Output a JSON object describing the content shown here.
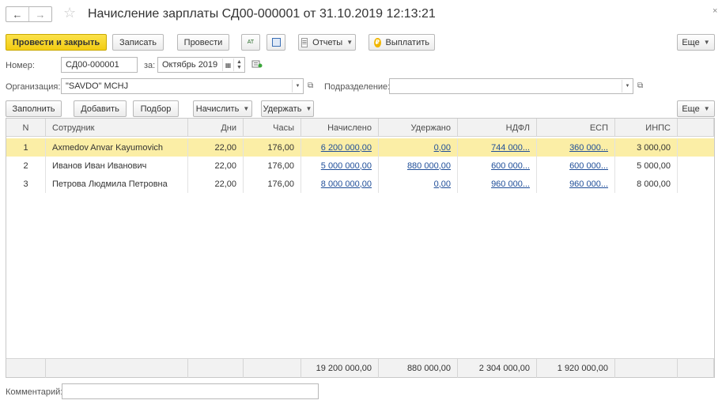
{
  "window": {
    "title": "Начисление зарплаты СД00-000001 от 31.10.2019 12:13:21",
    "back_glyph": "🡐",
    "forward_glyph": "→",
    "star_glyph": "☆",
    "close_glyph": "×"
  },
  "toolbar": {
    "post_close": "Провести и закрыть",
    "save": "Записать",
    "post": "Провести",
    "icon1_text": "АТ",
    "reports": "Отчеты",
    "pay": "Выплатить",
    "more": "Еще"
  },
  "form": {
    "number_label": "Номер:",
    "number_value": "СД00-000001",
    "for_label": "за:",
    "period_value": "Октябрь 2019",
    "org_label": "Организация:",
    "org_value": "\"SAVDO\" MCHJ",
    "dept_label": "Подразделение:",
    "dept_value": "",
    "comment_label": "Комментарий:",
    "comment_value": ""
  },
  "table_toolbar": {
    "fill": "Заполнить",
    "add": "Добавить",
    "select": "Подбор",
    "accrue": "Начислить",
    "withhold": "Удержать",
    "more": "Еще"
  },
  "table": {
    "columns": [
      "N",
      "Сотрудник",
      "Дни",
      "Часы",
      "Начислено",
      "Удержано",
      "НДФЛ",
      "ЕСП",
      "ИНПС"
    ],
    "rows": [
      {
        "n": "1",
        "employee": "Axmedov Anvar Kayumovich",
        "days": "22,00",
        "hours": "176,00",
        "accrued": "6 200 000,00",
        "withheld": "0,00",
        "ndfl": "744 000...",
        "esp": "360 000...",
        "inps": "3 000,00"
      },
      {
        "n": "2",
        "employee": "Иванов Иван Иванович",
        "days": "22,00",
        "hours": "176,00",
        "accrued": "5 000 000,00",
        "withheld": "880 000,00",
        "ndfl": "600 000...",
        "esp": "600 000...",
        "inps": "5 000,00"
      },
      {
        "n": "3",
        "employee": "Петрова Людмила Петровна",
        "days": "22,00",
        "hours": "176,00",
        "accrued": "8 000 000,00",
        "withheld": "0,00",
        "ndfl": "960 000...",
        "esp": "960 000...",
        "inps": "8 000,00"
      }
    ],
    "totals": {
      "accrued": "19 200 000,00",
      "withheld": "880 000,00",
      "ndfl": "2 304 000,00",
      "esp": "1 920 000,00"
    }
  },
  "colors": {
    "primary_button": "#f3cc13",
    "selected_row": "#fbeea6",
    "link": "#1f4e99"
  }
}
